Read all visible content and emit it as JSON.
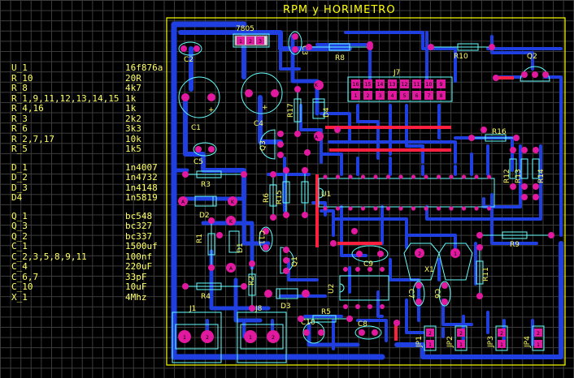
{
  "title": "RPM y HORIMETRO",
  "colors": {
    "background": "#000000",
    "grid": "#3d3d3d",
    "board_outline": "#ffff00",
    "copper_top": "#1f3fe0",
    "copper_highlight": "#ff1f3f",
    "pad": "#e0199e",
    "silkscreen": "#66ffff",
    "label_text": "#ffff66"
  },
  "bom": [
    {
      "ref": "U_1",
      "value": "16f876a"
    },
    {
      "ref": "R_10",
      "value": "20R"
    },
    {
      "ref": "R_8",
      "value": "4k7"
    },
    {
      "ref": "R_1,9,11,12,13,14,15",
      "value": "1k"
    },
    {
      "ref": "R_4,16",
      "value": "1k"
    },
    {
      "ref": "R_3",
      "value": "2k2"
    },
    {
      "ref": "R_6",
      "value": "3k3"
    },
    {
      "ref": "R_2,7,17",
      "value": "10k"
    },
    {
      "ref": "R_5",
      "value": "1k5"
    },
    {
      "ref": "D_1",
      "value": "1n4007",
      "gap_before": true
    },
    {
      "ref": "D_2",
      "value": "1n4732"
    },
    {
      "ref": "D_3",
      "value": "1n4148"
    },
    {
      "ref": "D4",
      "value": "1n5819"
    },
    {
      "ref": "Q_1",
      "value": "bc548",
      "gap_before": true
    },
    {
      "ref": "Q_3",
      "value": "bc327"
    },
    {
      "ref": "Q_2",
      "value": "bc337"
    },
    {
      "ref": "C_1",
      "value": "1500uf"
    },
    {
      "ref": "C_2,3,5,8,9,11",
      "value": "100nf"
    },
    {
      "ref": "C_4",
      "value": "220uF"
    },
    {
      "ref": "C_6,7",
      "value": "33pF"
    },
    {
      "ref": "C_10",
      "value": "10uF"
    },
    {
      "ref": "X_1",
      "value": "4Mhz"
    }
  ],
  "components": {
    "regulator": "7805",
    "C1": "C1",
    "C2": "C2",
    "C3": "C3",
    "C4": "C4",
    "C5": "C5",
    "C6": "C6",
    "C7": "C7",
    "C8": "C8",
    "C9": "C9",
    "C10": "C10",
    "C11": "C11",
    "R1": "R1",
    "R2": "R2",
    "R3": "R3",
    "R4": "R4",
    "R5": "R5",
    "R6": "R6",
    "R8": "R8",
    "R9": "R9",
    "R10": "R10",
    "R11": "R11",
    "R12": "R12",
    "R13": "R13",
    "R14": "R14",
    "R15": "R15",
    "R16": "R16",
    "R17": "R17",
    "D1": "D1",
    "D2": "D2",
    "D3": "D3",
    "D4": "D4",
    "Q1": "Q1",
    "Q2": "Q2",
    "Q3": "Q3",
    "U1": "U1",
    "U2": "U2",
    "X1": "X1",
    "J1": "J1",
    "J7": "J7",
    "J8": "J8",
    "JP1": "JP1",
    "JP2": "JP2",
    "JP3": "JP3",
    "JP4": "JP4",
    "K_marker": "K",
    "A_marker": "A"
  },
  "j7_pins_top": [
    "16",
    "15",
    "14",
    "13",
    "12",
    "11",
    "10",
    "9"
  ],
  "j7_pins_bottom": [
    "1",
    "2",
    "3",
    "4",
    "5",
    "6",
    "7",
    "8"
  ]
}
